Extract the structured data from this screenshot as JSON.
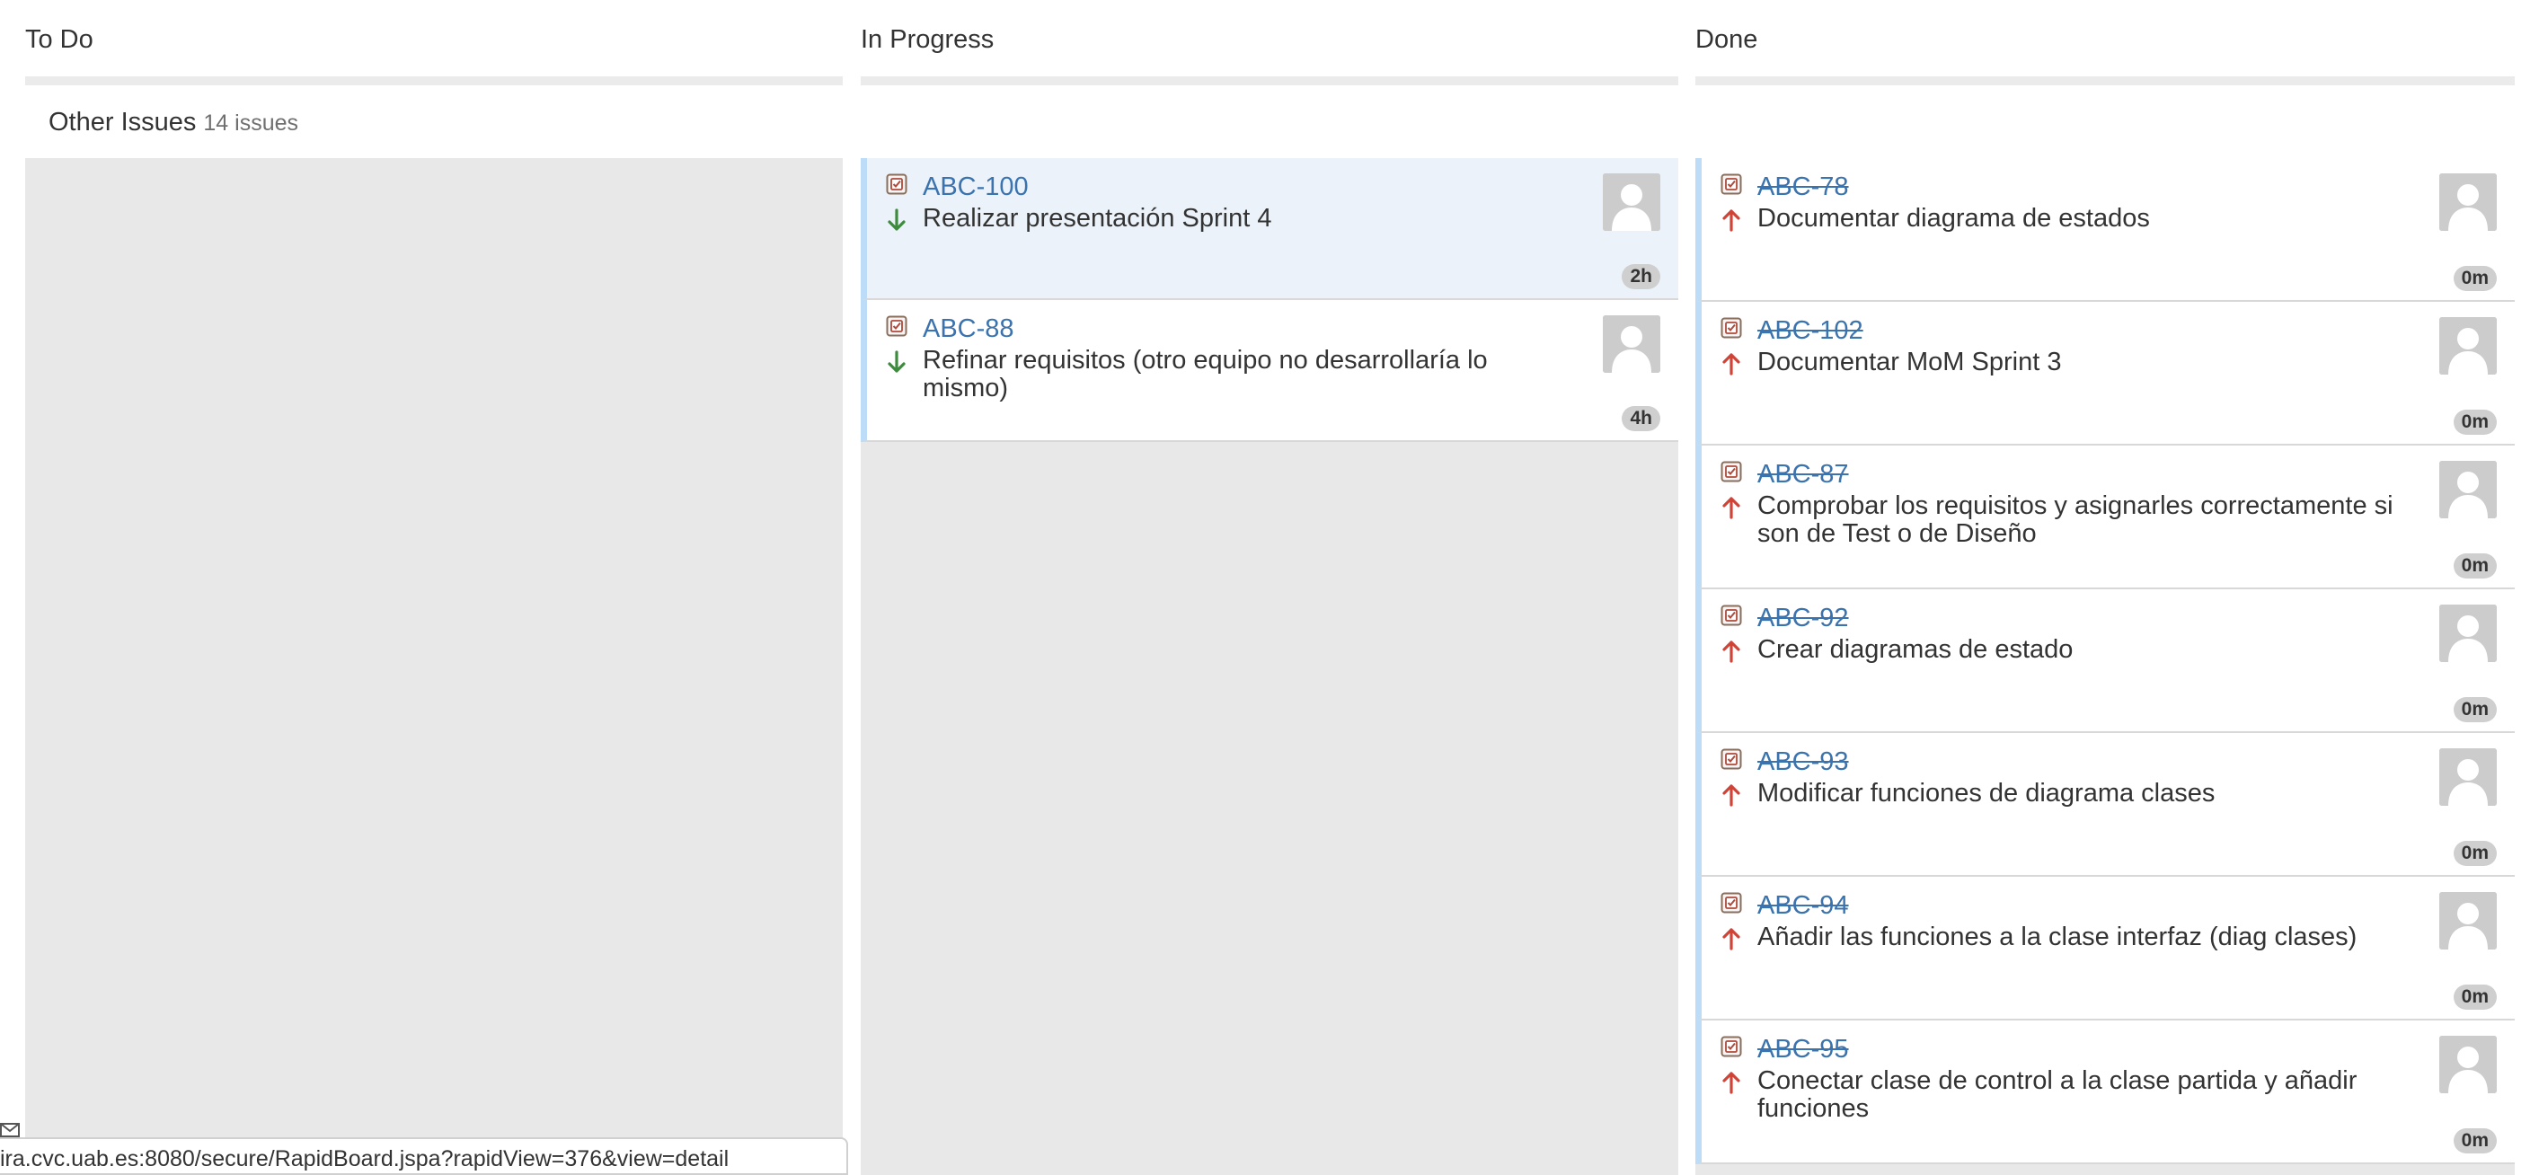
{
  "columns": [
    {
      "header": "To Do"
    },
    {
      "header": "In Progress"
    },
    {
      "header": "Done"
    }
  ],
  "swimlane": {
    "title": "Other Issues",
    "count": "14 issues"
  },
  "in_progress_cards": [
    {
      "key": "ABC-100",
      "summary": "Realizar presentación Sprint 4",
      "estimate": "2h",
      "priority": "low"
    },
    {
      "key": "ABC-88",
      "summary": "Refinar requisitos (otro equipo no desarrollaría lo mismo)",
      "estimate": "4h",
      "priority": "low"
    }
  ],
  "done_cards": [
    {
      "key": "ABC-78",
      "summary": "Documentar diagrama de estados",
      "estimate": "0m",
      "priority": "high"
    },
    {
      "key": "ABC-102",
      "summary": "Documentar MoM Sprint 3",
      "estimate": "0m",
      "priority": "high"
    },
    {
      "key": "ABC-87",
      "summary": "Comprobar los requisitos y asignarles correctamente si son de Test o de Diseño",
      "estimate": "0m",
      "priority": "high"
    },
    {
      "key": "ABC-92",
      "summary": "Crear diagramas de estado",
      "estimate": "0m",
      "priority": "high"
    },
    {
      "key": "ABC-93",
      "summary": "Modificar funciones de diagrama clases",
      "estimate": "0m",
      "priority": "high"
    },
    {
      "key": "ABC-94",
      "summary": "Añadir las funciones a la clase interfaz (diag clases)",
      "estimate": "0m",
      "priority": "high"
    },
    {
      "key": "ABC-95",
      "summary": "Conectar clase de control a la clase partida y añadir funciones",
      "estimate": "0m",
      "priority": "high"
    }
  ],
  "status_url": "ira.cvc.uab.es:8080/secure/RapidBoard.jspa?rapidView=376&view=detail",
  "colors": {
    "link": "#3b73af",
    "priority_low": "#3d8b3d",
    "priority_high": "#d04437",
    "card_border": "#bcdcf7",
    "selected_bg": "#ebf2f9",
    "column_bg": "#e8e8e8"
  },
  "icons": {
    "issue_type": "task-checkbox-icon",
    "priority_low": "arrow-down-icon",
    "priority_high": "arrow-up-icon",
    "avatar": "default-user-avatar-icon",
    "status": "envelope-icon"
  }
}
